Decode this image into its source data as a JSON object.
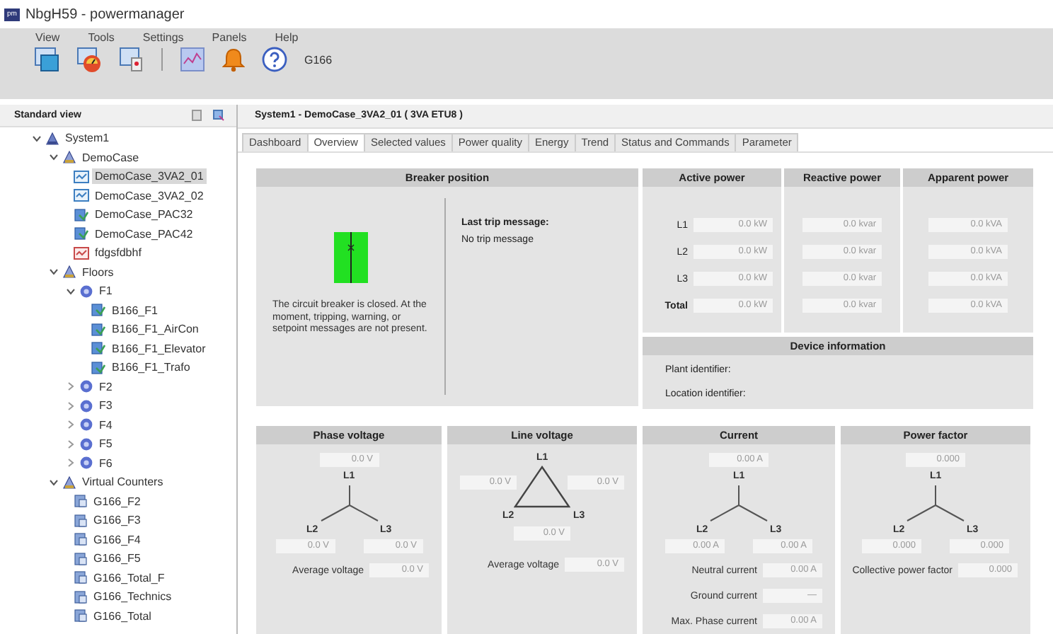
{
  "window": {
    "badge": "pm",
    "title": "NbgH59 - powermanager"
  },
  "menu": [
    "View",
    "Tools",
    "Settings",
    "Panels",
    "Help"
  ],
  "toolbar": {
    "label": "G166"
  },
  "navigator": {
    "title": "Standard view",
    "tree": [
      {
        "label": "System1",
        "kind": "system",
        "expanded": true,
        "selected": false,
        "children": [
          {
            "label": "DemoCase",
            "kind": "group",
            "expanded": true,
            "selected": false,
            "children": [
              {
                "label": "DemoCase_3VA2_01",
                "kind": "breaker",
                "selected": true
              },
              {
                "label": "DemoCase_3VA2_02",
                "kind": "breaker",
                "selected": false
              },
              {
                "label": "DemoCase_PAC32",
                "kind": "meter",
                "selected": false
              },
              {
                "label": "DemoCase_PAC42",
                "kind": "meter",
                "selected": false
              },
              {
                "label": "fdgsfdbhf",
                "kind": "alert",
                "selected": false
              }
            ]
          },
          {
            "label": "Floors",
            "kind": "group",
            "expanded": true,
            "selected": false,
            "children": [
              {
                "label": "F1",
                "kind": "floor",
                "expanded": true,
                "selected": false,
                "children": [
                  {
                    "label": "B166_F1",
                    "kind": "meter",
                    "selected": false
                  },
                  {
                    "label": "B166_F1_AirCon",
                    "kind": "meter",
                    "selected": false
                  },
                  {
                    "label": "B166_F1_Elevator",
                    "kind": "meter",
                    "selected": false
                  },
                  {
                    "label": "B166_F1_Trafo",
                    "kind": "meter",
                    "selected": false
                  }
                ]
              },
              {
                "label": "F2",
                "kind": "floor",
                "expanded": false,
                "selected": false
              },
              {
                "label": "F3",
                "kind": "floor",
                "expanded": false,
                "selected": false
              },
              {
                "label": "F4",
                "kind": "floor",
                "expanded": false,
                "selected": false
              },
              {
                "label": "F5",
                "kind": "floor",
                "expanded": false,
                "selected": false
              },
              {
                "label": "F6",
                "kind": "floor",
                "expanded": false,
                "selected": false
              }
            ]
          },
          {
            "label": "Virtual Counters",
            "kind": "group",
            "expanded": true,
            "selected": false,
            "children": [
              {
                "label": "G166_F2",
                "kind": "counter",
                "selected": false
              },
              {
                "label": "G166_F3",
                "kind": "counter",
                "selected": false
              },
              {
                "label": "G166_F4",
                "kind": "counter",
                "selected": false
              },
              {
                "label": "G166_F5",
                "kind": "counter",
                "selected": false
              },
              {
                "label": "G166_Total_F",
                "kind": "counter",
                "selected": false
              },
              {
                "label": "G166_Technics",
                "kind": "counter",
                "selected": false
              },
              {
                "label": "G166_Total",
                "kind": "counter",
                "selected": false
              }
            ]
          }
        ]
      }
    ]
  },
  "device": {
    "title": "System1 - DemoCase_3VA2_01 ( 3VA ETU8 )",
    "tabs": [
      {
        "label": "Dashboard",
        "selected": false
      },
      {
        "label": "Overview",
        "selected": true
      },
      {
        "label": "Selected values",
        "selected": false
      },
      {
        "label": "Power quality",
        "selected": false
      },
      {
        "label": "Energy",
        "selected": false
      },
      {
        "label": "Trend",
        "selected": false
      },
      {
        "label": "Status and Commands",
        "selected": false
      },
      {
        "label": "Parameter",
        "selected": false
      }
    ],
    "breaker": {
      "title": "Breaker position",
      "closed": true,
      "status": "The circuit breaker is closed. At the moment, tripping, warning, or setpoint messages are not present.",
      "trip_label": "Last trip message:",
      "trip_message": "No trip message"
    },
    "power": {
      "columns": [
        "Active power",
        "Reactive power",
        "Apparent power"
      ],
      "rows": [
        {
          "label": "L1",
          "kind": "phase",
          "values": [
            "0.0 kW",
            "0.0 kvar",
            "0.0 kVA"
          ]
        },
        {
          "label": "L2",
          "kind": "phase",
          "values": [
            "0.0 kW",
            "0.0 kvar",
            "0.0 kVA"
          ]
        },
        {
          "label": "L3",
          "kind": "phase",
          "values": [
            "0.0 kW",
            "0.0 kvar",
            "0.0 kVA"
          ]
        },
        {
          "label": "Total",
          "kind": "total",
          "values": [
            "0.0 kW",
            "0.0 kvar",
            "0.0 kVA"
          ]
        }
      ]
    },
    "device_info": {
      "title": "Device information",
      "fields": [
        "Plant identifier:",
        "Location identifier:"
      ]
    },
    "measurements": [
      {
        "title": "Phase voltage",
        "kind": "star",
        "phases": [
          "L1",
          "L2",
          "L3"
        ],
        "values": [
          "0.0 V",
          "0.0 V",
          "0.0 V"
        ],
        "extras": [
          {
            "label": "Average voltage",
            "value": "0.0 V"
          }
        ]
      },
      {
        "title": "Line voltage",
        "kind": "delta",
        "phases": [
          "L1",
          "L2",
          "L3"
        ],
        "values": [
          "0.0 V",
          "0.0 V",
          "0.0 V"
        ],
        "extras": [
          {
            "label": "Average voltage",
            "value": "0.0 V"
          }
        ]
      },
      {
        "title": "Current",
        "kind": "star",
        "phases": [
          "L1",
          "L2",
          "L3"
        ],
        "values": [
          "0.00 A",
          "0.00 A",
          "0.00 A"
        ],
        "extras": [
          {
            "label": "Neutral current",
            "value": "0.00 A"
          },
          {
            "label": "Ground current",
            "value": "—"
          },
          {
            "label": "Max. Phase current",
            "value": "0.00 A"
          }
        ]
      },
      {
        "title": "Power factor",
        "kind": "star",
        "phases": [
          "L1",
          "L2",
          "L3"
        ],
        "values": [
          "0.000",
          "0.000",
          "0.000"
        ],
        "extras": [
          {
            "label": "Collective power factor",
            "value": "0.000"
          }
        ]
      }
    ]
  }
}
